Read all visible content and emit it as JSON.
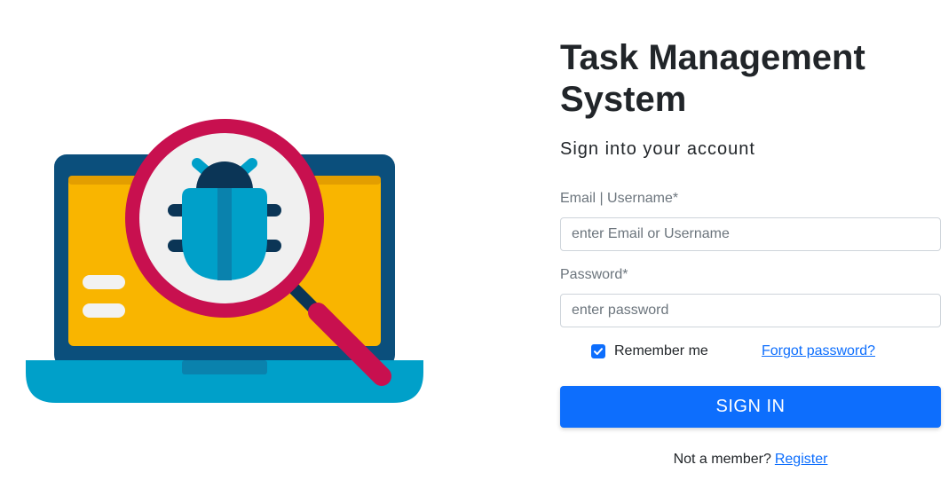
{
  "app": {
    "title": "Task Management System",
    "subtitle": "Sign into your account"
  },
  "illustration": {
    "icon": "bug-search-laptop-illustration",
    "colors": {
      "laptop_frame": "#0b4f7c",
      "screen": "#f9b500",
      "magnifier_ring": "#c8104f",
      "bug": "#00a0c9",
      "base": "#00a0c9"
    }
  },
  "form": {
    "email": {
      "label": "Email | Username*",
      "placeholder": "enter Email or Username",
      "value": ""
    },
    "password": {
      "label": "Password*",
      "placeholder": "enter password",
      "value": ""
    },
    "remember": {
      "label": "Remember me",
      "checked": true
    },
    "forgot_label": "Forgot password?",
    "submit_label": "SIGN IN",
    "register_prompt": "Not a member?",
    "register_label": "Register"
  },
  "colors": {
    "primary": "#0d6efd",
    "text": "#212529",
    "muted": "#6c757d"
  }
}
